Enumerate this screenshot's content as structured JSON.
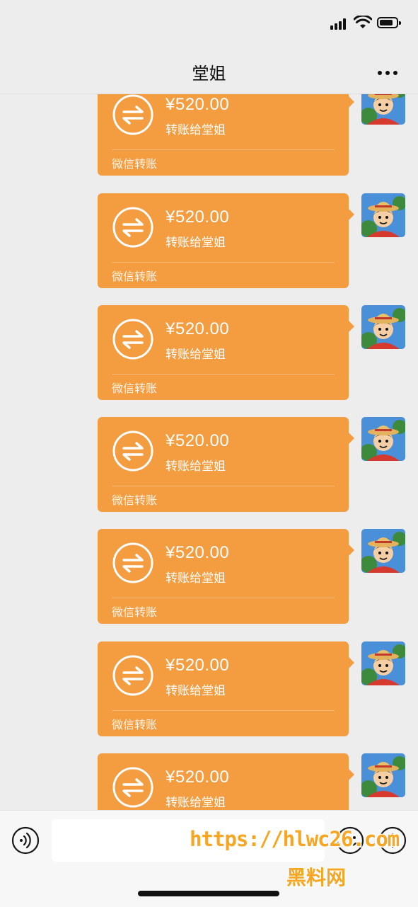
{
  "nav": {
    "title": "堂姐"
  },
  "colors": {
    "transfer_bubble": "#f39c40",
    "background": "#ededed",
    "watermark": "#f6a623"
  },
  "messages": [
    {
      "amount": "¥520.00",
      "note": "转账给堂姐",
      "footer": "微信转账"
    },
    {
      "amount": "¥520.00",
      "note": "转账给堂姐",
      "footer": "微信转账"
    },
    {
      "amount": "¥520.00",
      "note": "转账给堂姐",
      "footer": "微信转账"
    },
    {
      "amount": "¥520.00",
      "note": "转账给堂姐",
      "footer": "微信转账"
    },
    {
      "amount": "¥520.00",
      "note": "转账给堂姐",
      "footer": "微信转账"
    },
    {
      "amount": "¥520.00",
      "note": "转账给堂姐",
      "footer": "微信转账"
    },
    {
      "amount": "¥520.00",
      "note": "转账给堂姐",
      "footer": ""
    }
  ],
  "input": {
    "value": "",
    "placeholder": ""
  },
  "watermark": {
    "url": "https://hlwc26.com",
    "text": "黑料网"
  },
  "icons": [
    "signal-icon",
    "wifi-icon",
    "battery-icon",
    "more-icon",
    "transfer-icon",
    "voice-icon",
    "emoji-icon",
    "plus-icon"
  ]
}
